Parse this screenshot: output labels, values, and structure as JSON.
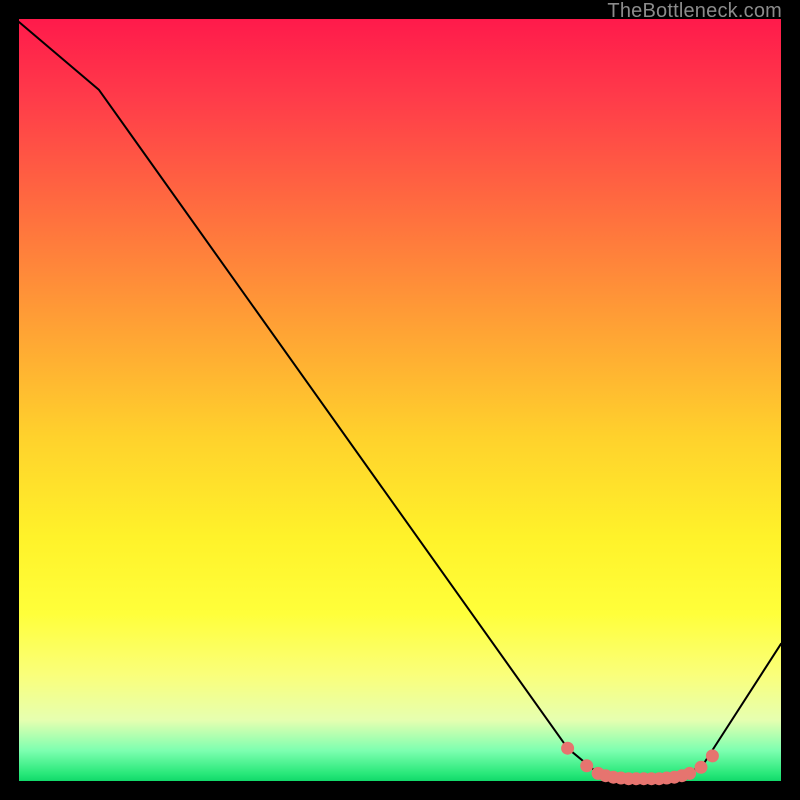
{
  "attribution": "TheBottleneck.com",
  "colors": {
    "marker": "#e6746f",
    "line": "#000000"
  },
  "chart_data": {
    "type": "line",
    "title": "",
    "xlabel": "",
    "ylabel": "",
    "xlim": [
      0,
      100
    ],
    "ylim": [
      0,
      100
    ],
    "grid": false,
    "legend": false,
    "annotations": [],
    "series": [
      {
        "name": "curve",
        "x": [
          0,
          10.5,
          72,
          76,
          78,
          80,
          82,
          84,
          86,
          88,
          90,
          100
        ],
        "y": [
          99.6,
          90.7,
          4.3,
          1.0,
          0.5,
          0.3,
          0.3,
          0.3,
          0.5,
          1.0,
          2.5,
          18.0
        ],
        "markers_at": [
          {
            "x": 72,
            "y": 4.3
          },
          {
            "x": 74.5,
            "y": 2.0
          },
          {
            "x": 76,
            "y": 1.0
          },
          {
            "x": 77,
            "y": 0.7
          },
          {
            "x": 78,
            "y": 0.5
          },
          {
            "x": 79,
            "y": 0.4
          },
          {
            "x": 80,
            "y": 0.3
          },
          {
            "x": 81,
            "y": 0.3
          },
          {
            "x": 82,
            "y": 0.3
          },
          {
            "x": 83,
            "y": 0.3
          },
          {
            "x": 84,
            "y": 0.3
          },
          {
            "x": 85,
            "y": 0.4
          },
          {
            "x": 86,
            "y": 0.5
          },
          {
            "x": 87,
            "y": 0.7
          },
          {
            "x": 88,
            "y": 1.0
          },
          {
            "x": 89.5,
            "y": 1.8
          },
          {
            "x": 91,
            "y": 3.3
          }
        ]
      }
    ]
  }
}
